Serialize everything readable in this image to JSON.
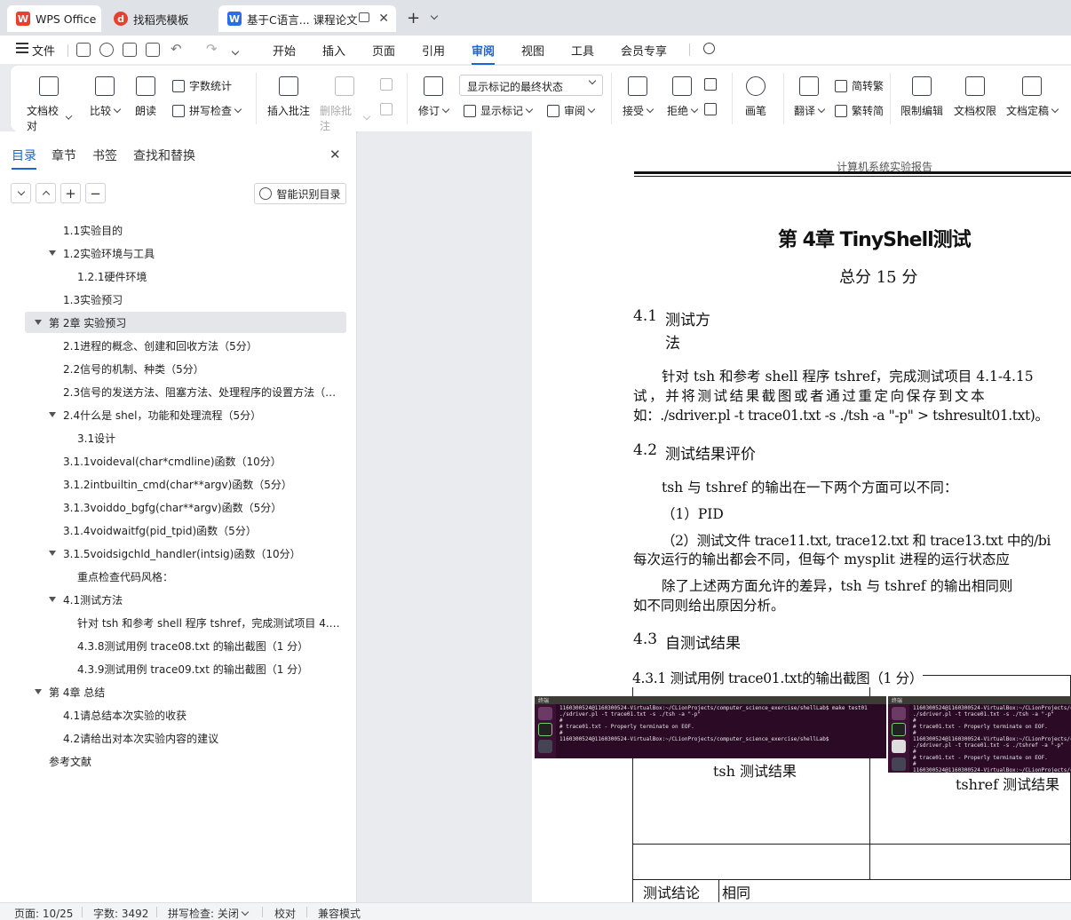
{
  "tabs": [
    {
      "label": "WPS Office",
      "icon": "wps-logo-icon",
      "color": "#e8402f"
    },
    {
      "label": "找稻壳模板",
      "icon": "docer-icon",
      "color": "#e8402f"
    },
    {
      "label": "基于C语言... 课程论文",
      "icon": "word-doc-icon",
      "color": "#2b6de3"
    }
  ],
  "menu": {
    "file": "文件",
    "items": [
      "开始",
      "插入",
      "页面",
      "引用",
      "审阅",
      "视图",
      "工具",
      "会员专享"
    ],
    "active": "审阅"
  },
  "ribbon": {
    "doc_check": "文档校对",
    "compare": "比较",
    "read_aloud": "朗读",
    "word_count": "字数统计",
    "spell_check": "拼写检查",
    "insert_comment": "插入批注",
    "delete_comment": "删除批注",
    "revise": "修订",
    "markup_state": "显示标记的最终状态",
    "show_markup": "显示标记",
    "review": "审阅",
    "accept": "接受",
    "reject": "拒绝",
    "pen": "画笔",
    "translate": "翻译",
    "simp_to_trad": "简转繁",
    "trad_to_simp": "繁转简",
    "restrict_edit": "限制编辑",
    "doc_rights": "文档权限",
    "doc_finalize": "文档定稿"
  },
  "sidebar": {
    "tabs": [
      "目录",
      "章节",
      "书签",
      "查找和替换"
    ],
    "smart_btn": "智能识别目录",
    "toc": [
      {
        "text": "1.1实验目的",
        "level": 2,
        "caret": false,
        "selected": false
      },
      {
        "text": "1.2实验环境与工具",
        "level": 2,
        "caret": true,
        "selected": false
      },
      {
        "text": "1.2.1硬件环境",
        "level": 3,
        "caret": false,
        "selected": false
      },
      {
        "text": "1.3实验预习",
        "level": 2,
        "caret": false,
        "selected": false
      },
      {
        "text": "第 2章 实验预习",
        "level": 1,
        "caret": true,
        "selected": true
      },
      {
        "text": "2.1进程的概念、创建和回收方法（5分）",
        "level": 2,
        "caret": false,
        "selected": false
      },
      {
        "text": "2.2信号的机制、种类（5分）",
        "level": 2,
        "caret": false,
        "selected": false
      },
      {
        "text": "2.3信号的发送方法、阻塞方法、处理程序的设置方法（…",
        "level": 2,
        "caret": false,
        "selected": false
      },
      {
        "text": "2.4什么是 shel，功能和处理流程（5分）",
        "level": 2,
        "caret": true,
        "selected": false
      },
      {
        "text": "3.1设计",
        "level": 3,
        "caret": false,
        "selected": false
      },
      {
        "text": "3.1.1voideval(char*cmdline)函数（10分）",
        "level": 2,
        "caret": false,
        "selected": false
      },
      {
        "text": "3.1.2intbuiltin_cmd(char**argv)函数（5分）",
        "level": 2,
        "caret": false,
        "selected": false
      },
      {
        "text": "3.1.3voiddo_bgfg(char**argv)函数（5分）",
        "level": 2,
        "caret": false,
        "selected": false
      },
      {
        "text": "3.1.4voidwaitfg(pid_tpid)函数（5分）",
        "level": 2,
        "caret": false,
        "selected": false
      },
      {
        "text": "3.1.5voidsigchld_handler(intsig)函数（10分）",
        "level": 2,
        "caret": true,
        "selected": false
      },
      {
        "text": "重点检查代码风格：",
        "level": 3,
        "caret": false,
        "selected": false
      },
      {
        "text": "4.1测试方法",
        "level": 2,
        "caret": true,
        "selected": false
      },
      {
        "text": "针对 tsh 和参考 shell 程序 tshref，完成测试项目 4.1 …",
        "level": 3,
        "caret": false,
        "selected": false
      },
      {
        "text": "4.3.8测试用例 trace08.txt 的输出截图（1 分）",
        "level": 3,
        "caret": false,
        "selected": false
      },
      {
        "text": "4.3.9测试用例 trace09.txt 的输出截图（1 分）",
        "level": 3,
        "caret": false,
        "selected": false
      },
      {
        "text": "第 4章 总结",
        "level": 1,
        "caret": true,
        "selected": false
      },
      {
        "text": "4.1请总结本次实验的收获",
        "level": 2,
        "caret": false,
        "selected": false
      },
      {
        "text": "4.2请给出对本次实验内容的建议",
        "level": 2,
        "caret": false,
        "selected": false
      },
      {
        "text": "参考文献",
        "level": 1,
        "caret": false,
        "selected": false
      }
    ]
  },
  "document": {
    "header": "计算机系统实验报告",
    "chapter": "第 4章 TinyShell测试",
    "total_score": "总分  15 分",
    "s41_num": "4.1",
    "s41_title_1": "测试方",
    "s41_title_2": "法",
    "p1_1": "针对 tsh 和参考 shell 程序 tshref，完成测试项目 4.1-4.15",
    "p1_2": "试，并将测试结果截图或者通过重定向保存到文本",
    "p1_3": "如：./sdriver.pl -t trace01.txt -s ./tsh -a \"-p\" > tshresult01.txt)。",
    "s42_num": "4.2",
    "s42_title": "测试结果评价",
    "p2_1": "tsh 与 tshref 的输出在一下两个方面可以不同：",
    "p2_2": "（1）PID",
    "p2_3": "（2）测试文件 trace11.txt, trace12.txt 和 trace13.txt 中的/bi",
    "p2_4": "每次运行的输出都会不同，但每个 mysplit 进程的运行状态应",
    "p2_5": "除了上述两方面允许的差异，tsh 与 tshref 的输出相同则",
    "p2_6": "如不同则给出原因分析。",
    "s43_num": "4.3",
    "s43_title": "自测试结果",
    "s431": "4.3.1 测试用例 trace01.txt的输出截图（1 分）",
    "tsh_result": "tsh 测试结果",
    "tshref_result": "tshref 测试结果",
    "conclusion_label": "测试结论",
    "conclusion_value": "相同",
    "terminal_title": "终端",
    "terminal_left": [
      "1160300524@1160300524-VirtualBox:~/CLionProjects/computer_science_exercise/shellLab$ make test01",
      "./sdriver.pl -t trace01.txt -s ./tsh -a \"-p\"",
      "#",
      "# trace01.txt - Properly terminate on EOF.",
      "#",
      "1160300524@1160300524-VirtualBox:~/CLionProjects/computer_science_exercise/shellLab$"
    ],
    "terminal_right": [
      "1160300524@1160300524-VirtualBox:~/CLionProjects/computer_",
      "./sdriver.pl -t trace01.txt -s ./tsh -a \"-p\"",
      "#",
      "# trace01.txt - Properly terminate on EOF.",
      "#",
      "1160300524@1160300524-VirtualBox:~/CLionProjects/computer_sc",
      "./sdriver.pl -t trace01.txt -s ./tshref -a \"-p\"",
      "#",
      "# trace01.txt - Properly terminate on EOF.",
      "#",
      "1160300524@1160300524-VirtualBox:~/CLionProjects/computer_"
    ]
  },
  "status": {
    "page": "页面: 10/25",
    "words": "字数: 3492",
    "spell": "拼写检查: 关闭",
    "proof": "校对",
    "compat": "兼容模式"
  },
  "colors": {
    "accent": "#1765d8",
    "terminal_bg": "#2b0a26"
  }
}
